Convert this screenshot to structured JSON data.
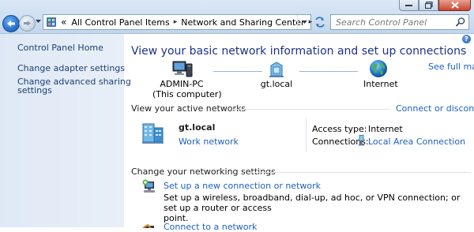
{
  "window": {
    "buttons": {
      "minimize": "minimize",
      "maximize": "maximize",
      "close": "close"
    }
  },
  "address": {
    "overflow": "«",
    "crumbs": [
      "All Control Panel Items",
      "Network and Sharing Center"
    ],
    "separator": "▸"
  },
  "search": {
    "placeholder": "Search Control Panel"
  },
  "sidebar": {
    "items": [
      {
        "label": "Control Panel Home"
      },
      {
        "label": "Change adapter settings"
      },
      {
        "label": "Change advanced sharing"
      },
      {
        "label": "settings"
      }
    ]
  },
  "main": {
    "help": "?",
    "headline": "View your basic network information and set up connections",
    "see_full_map": "See full map",
    "map": {
      "computer_name": "ADMIN-PC",
      "computer_sub": "(This computer)",
      "network": "gt.local",
      "internet": "Internet"
    },
    "active": {
      "title": "View your active networks",
      "connect_link": "Connect or disconnect",
      "network_name": "gt.local",
      "network_type": "Work network",
      "access_label": "Access type:",
      "access_value": "Internet",
      "connections_label": "Connections:",
      "connections_value": "Local Area Connection"
    },
    "settings": {
      "title": "Change your networking settings",
      "items": [
        {
          "link": "Set up a new connection or network",
          "desc1": "Set up a wireless, broadband, dial-up, ad hoc, or VPN connection; or set up a router or access",
          "desc2": "point."
        },
        {
          "link": "Connect to a network"
        }
      ]
    }
  },
  "icons": {
    "back": "back-arrow-icon",
    "forward": "forward-arrow-icon",
    "computer": "computer-icon",
    "network": "network-house-icon",
    "globe": "globe-icon"
  },
  "colors": {
    "link": "#1f5fbf",
    "headline": "#1e3287",
    "sidebar_link": "#1c3f74",
    "sidebar_bg": "#dfe9f5",
    "topbar_bg": "#cfe0f2"
  }
}
